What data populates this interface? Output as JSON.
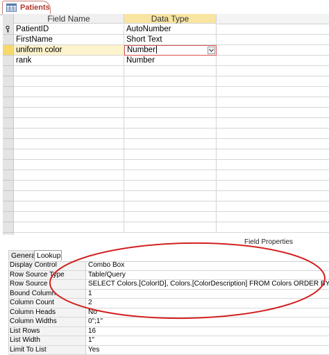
{
  "document_tab": {
    "label": "Patients",
    "icon": "table-icon"
  },
  "design_grid": {
    "headers": {
      "field_name": "Field Name",
      "data_type": "Data Type"
    },
    "rows": [
      {
        "name": "PatientID",
        "type": "AutoNumber",
        "primary_key": true
      },
      {
        "name": "FirstName",
        "type": "Short Text"
      },
      {
        "name": "uniform color",
        "type": "Number",
        "current": true
      },
      {
        "name": "rank",
        "type": "Number"
      }
    ]
  },
  "field_properties": {
    "title": "Field Properties",
    "tabs": {
      "general": "General",
      "lookup": "Lookup"
    },
    "active_tab": "Lookup",
    "rows": [
      {
        "label": "Display Control",
        "value": "Combo Box"
      },
      {
        "label": "Row Source Type",
        "value": "Table/Query"
      },
      {
        "label": "Row Source",
        "value": "SELECT Colors.[ColorID], Colors.[ColorDescription] FROM Colors ORDER BY [ColorID];"
      },
      {
        "label": "Bound Column",
        "value": "1"
      },
      {
        "label": "Column Count",
        "value": "2"
      },
      {
        "label": "Column Heads",
        "value": "No"
      },
      {
        "label": "Column Widths",
        "value": "0\";1\""
      },
      {
        "label": "List Rows",
        "value": "16"
      },
      {
        "label": "List Width",
        "value": "1\""
      },
      {
        "label": "Limit To List",
        "value": "Yes"
      }
    ]
  },
  "colors": {
    "tab_text": "#b03a2e",
    "data_type_header": "#f9e5a2",
    "current_row_selector": "#f7d86b",
    "annotation": "#d32020"
  }
}
